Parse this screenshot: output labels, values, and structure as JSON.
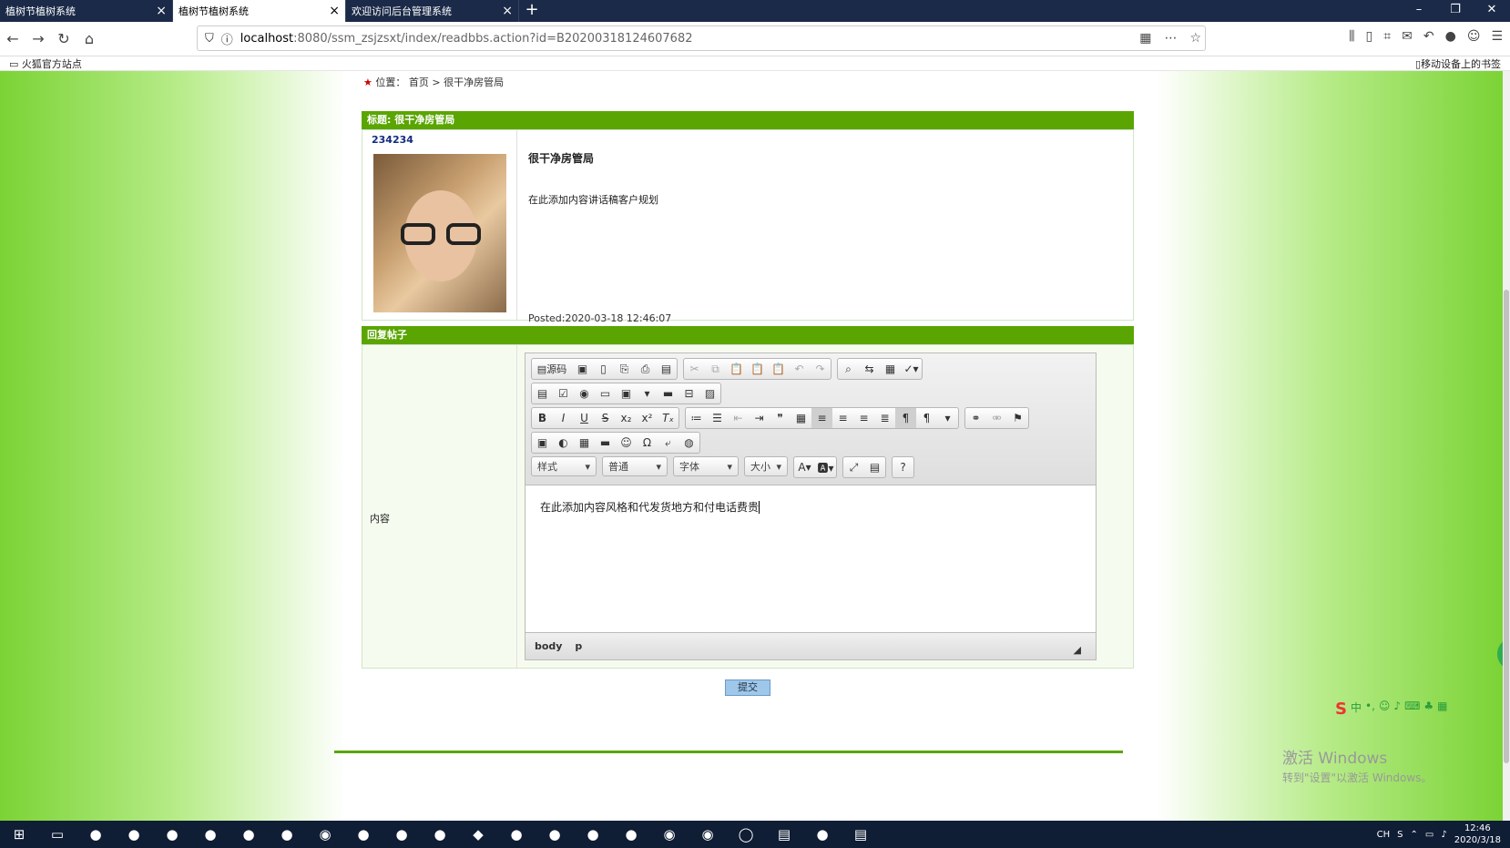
{
  "browser": {
    "tabs": [
      {
        "label": "植树节植树系统",
        "active": false
      },
      {
        "label": "植树节植树系统",
        "active": true
      },
      {
        "label": "欢迎访问后台管理系统",
        "active": false
      }
    ],
    "new_tab": "+",
    "url_host": "localhost",
    "url_path": ":8080/ssm_zsjzsxt/index/readbbs.action?id=B20200318124607682",
    "bookmark_left": "火狐官方站点",
    "bookmark_right": "移动设备上的书签"
  },
  "breadcrumb": {
    "label": "位置：",
    "home": "首页",
    "sep": ">",
    "current": "很干净房管局"
  },
  "post": {
    "header": "标题: 很干净房管局",
    "username": "234234",
    "title": "很干净房管局",
    "body": "在此添加内容讲话稿客户规划",
    "posted": "Posted:2020-03-18 12:46:07"
  },
  "reply": {
    "header": "回复帖子",
    "field_label": "内容",
    "source_button": "源码",
    "combos": [
      "样式",
      "普通",
      "字体",
      "大小"
    ],
    "editor_text": "在此添加内容风格和代发货地方和付电话费贵",
    "path": [
      "body",
      "p"
    ],
    "submit": "提交"
  },
  "watermark": {
    "line1": "激活 Windows",
    "line2": "转到\"设置\"以激活 Windows。"
  },
  "taskbar": {
    "lang": "CH",
    "time": "12:46",
    "date": "2020/3/18"
  },
  "icons": [
    "back-icon",
    "forward-icon",
    "reload-icon",
    "home-icon",
    "shield-icon",
    "info-icon",
    "star-icon",
    "folder-icon"
  ]
}
